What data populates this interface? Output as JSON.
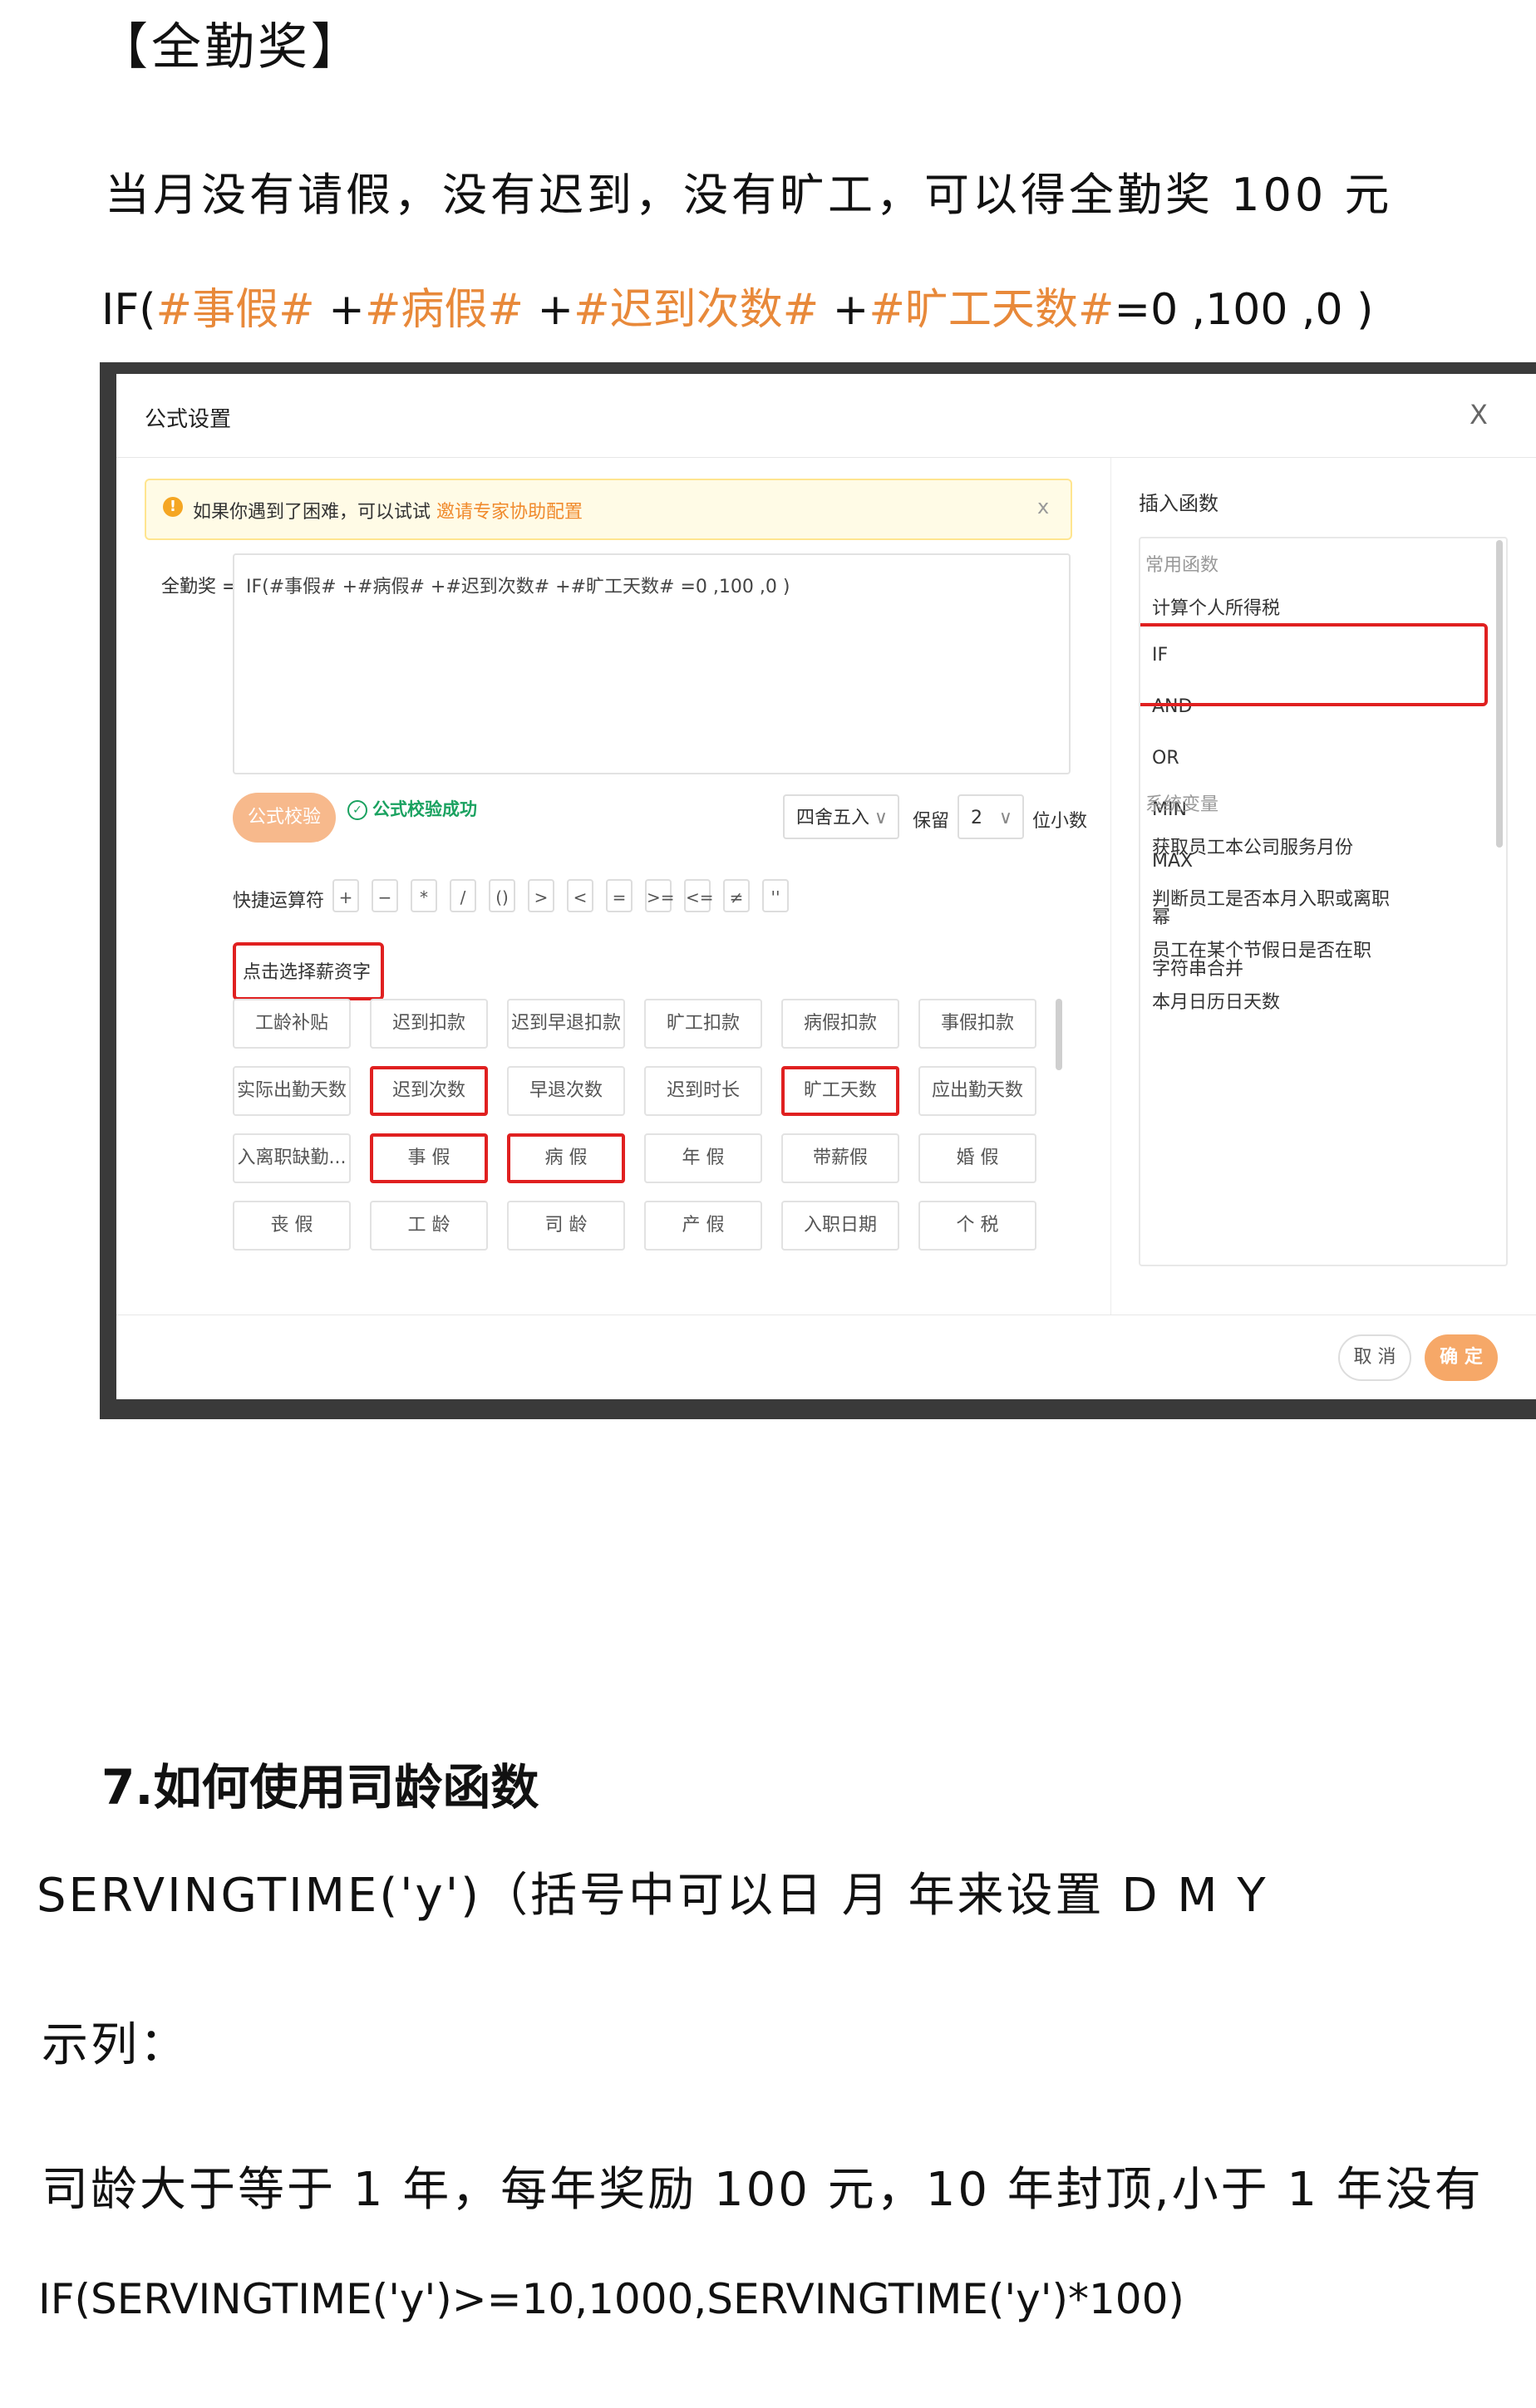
{
  "heading_award": "【全勤奖】",
  "rule_text": "当月没有请假，没有迟到，没有旷工，可以得全勤奖 100 元",
  "formula": {
    "prefix": "IF(",
    "f1": "#事假#",
    "plus": " +",
    "f2": "#病假#",
    "f3": "#迟到次数#",
    "f4": "#旷工天数#",
    "suffix": "=0 ,100 ,0 )"
  },
  "dialog": {
    "title": "公式设置",
    "close": "X",
    "notice_text": "如果你遇到了困难，可以试试 ",
    "notice_link": "邀请专家协助配置",
    "notice_close": "x",
    "field_label": "全勤奖 =",
    "formula_value": "IF(#事假# +#病假# +#迟到次数# +#旷工天数# =0 ,100 ,0 )",
    "verify_button": "公式校验",
    "verify_ok": "公式校验成功",
    "round_mode": "四舍五入",
    "keep_label": "保留",
    "decimals": "2",
    "decimals_label": "位小数",
    "ops_label": "快捷运算符",
    "ops": [
      "+",
      "−",
      "*",
      "/",
      "()",
      ">",
      "<",
      "=",
      ">=",
      "<=",
      "≠",
      "''"
    ],
    "pick_label": "点击选择薪资字段",
    "fields": [
      [
        "工龄补贴",
        "迟到扣款",
        "迟到早退扣款",
        "旷工扣款",
        "病假扣款",
        "事假扣款"
      ],
      [
        "实际出勤天数",
        "迟到次数",
        "早退次数",
        "迟到时长",
        "旷工天数",
        "应出勤天数"
      ],
      [
        "入离职缺勤...",
        "事 假",
        "病 假",
        "年 假",
        "带薪假",
        "婚 假"
      ],
      [
        "丧 假",
        "工 龄",
        "司 龄",
        "产 假",
        "入职日期",
        "个 税"
      ]
    ],
    "highlighted_fields": [
      "迟到次数",
      "旷工天数",
      "事 假",
      "病 假"
    ],
    "fn_title": "插入函数",
    "fn_group_common": "常用函数",
    "fn_common": [
      "计算个人所得税",
      "IF",
      "AND",
      "OR",
      "MIN",
      "MAX",
      "幂",
      "字符串合并"
    ],
    "fn_group_system": "系统变量",
    "fn_system": [
      "获取员工本公司服务月份",
      "判断员工是否本月入职或离职",
      "员工在某个节假日是否在职",
      "本月日历日天数"
    ],
    "cancel": "取 消",
    "ok": "确 定"
  },
  "section_heading": "7.如何使用司龄函数",
  "serving_text": "SERVINGTIME('y')（括号中可以日  月  年来设置 D M Y",
  "example_label": "示列：",
  "desc_text": "司龄大于等于 1 年，每年奖励 100 元，10 年封顶,小于 1 年没有",
  "formula2": "IF(SERVINGTIME('y')>=10,1000,SERVINGTIME('y')*100)",
  "colors": {
    "accent": "#f6a868",
    "highlight": "#e02020",
    "field_orange": "#e8893a",
    "success": "#1aa260"
  }
}
